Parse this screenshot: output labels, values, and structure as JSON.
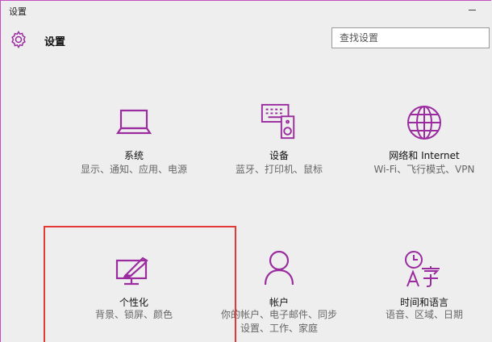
{
  "window": {
    "title": "设置"
  },
  "header": {
    "app_title": "设置",
    "search_placeholder": "查找设置"
  },
  "accent": "#9b2ca0",
  "tiles": [
    {
      "name": "系统",
      "desc": "显示、通知、应用、电源",
      "icon": "laptop-icon"
    },
    {
      "name": "设备",
      "desc": "蓝牙、打印机、鼠标",
      "icon": "devices-icon"
    },
    {
      "name": "网络和 Internet",
      "desc": "Wi-Fi、飞行模式、VPN",
      "icon": "globe-icon"
    },
    {
      "name": "个性化",
      "desc": "背景、锁屏、颜色",
      "icon": "personalization-icon"
    },
    {
      "name": "帐户",
      "desc": "你的帐户、电子邮件、同步设置、工作、家庭",
      "icon": "person-icon"
    },
    {
      "name": "时间和语言",
      "desc": "语音、区域、日期",
      "icon": "time-language-icon"
    }
  ]
}
